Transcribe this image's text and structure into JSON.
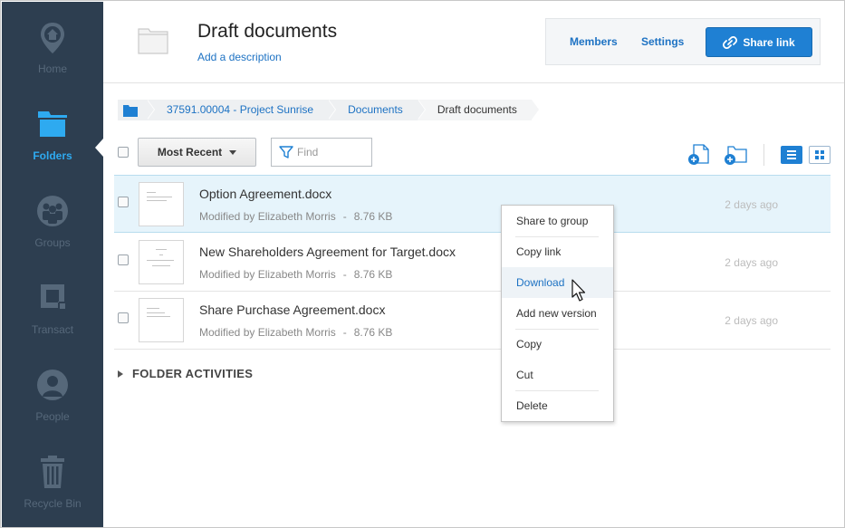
{
  "sidebar": {
    "items": [
      {
        "label": "Home",
        "icon": "map-pin-icon"
      },
      {
        "label": "Folders",
        "icon": "folder-icon",
        "active": true
      },
      {
        "label": "Groups",
        "icon": "groups-icon"
      },
      {
        "label": "Transact",
        "icon": "transact-icon"
      },
      {
        "label": "People",
        "icon": "person-icon"
      },
      {
        "label": "Recycle Bin",
        "icon": "trash-icon"
      }
    ]
  },
  "header": {
    "title": "Draft documents",
    "add_description": "Add a description",
    "members_label": "Members",
    "settings_label": "Settings",
    "share_link_label": "Share link"
  },
  "breadcrumb": {
    "items": [
      "37591.00004 - Project Sunrise",
      "Documents",
      "Draft documents"
    ]
  },
  "toolbar": {
    "sort_label": "Most Recent",
    "find_placeholder": "Find"
  },
  "files": [
    {
      "name": "Option Agreement.docx",
      "modified_by": "Modified by Elizabeth Morris",
      "size": "8.76 KB",
      "date": "2 days ago",
      "selected": true
    },
    {
      "name": "New Shareholders Agreement for Target.docx",
      "modified_by": "Modified by Elizabeth Morris",
      "size": "8.76 KB",
      "date": "2 days ago"
    },
    {
      "name": "Share Purchase Agreement.docx",
      "modified_by": "Modified by Elizabeth Morris",
      "size": "8.76 KB",
      "date": "2 days ago"
    }
  ],
  "folder_activities_label": "FOLDER ACTIVITIES",
  "context_menu": {
    "items": [
      "Share to group",
      "Copy link",
      "Download",
      "Add new version",
      "Copy",
      "Cut",
      "Delete"
    ],
    "hovered": "Download"
  },
  "colors": {
    "sidebar_bg": "#2d3e50",
    "accent": "#1f80d3",
    "link": "#1d72c3",
    "selected_row": "#e6f4fb"
  }
}
